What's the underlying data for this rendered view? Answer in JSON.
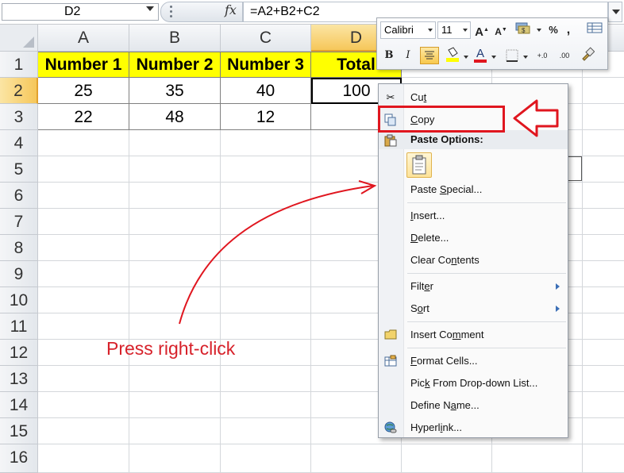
{
  "formula_bar": {
    "name_box": "D2",
    "fx_label": "fx",
    "formula": "=A2+B2+C2"
  },
  "grid": {
    "columns": [
      "A",
      "B",
      "C",
      "D"
    ],
    "rows": [
      "1",
      "2",
      "3",
      "4",
      "5",
      "6",
      "7",
      "8",
      "9",
      "10",
      "11",
      "12",
      "13",
      "14",
      "15",
      "16"
    ],
    "cells": {
      "A1": "Number 1",
      "B1": "Number 2",
      "C1": "Number 3",
      "D1": "Total",
      "A2": "25",
      "B2": "35",
      "C2": "40",
      "D2": "100",
      "A3": "22",
      "B3": "48",
      "C3": "12",
      "D3": ""
    },
    "selected_cell": "D2"
  },
  "mini_toolbar": {
    "font_name": "Calibri",
    "font_size": "11",
    "grow_font": "A",
    "shrink_font": "A",
    "currency": "$",
    "percent": "%",
    "comma": ",",
    "bold": "B",
    "italic": "I",
    "font_color_label": "A",
    "increase_decimal": "+.0",
    "decrease_decimal": ".00",
    "accent_fill": "#ffff00",
    "accent_font": "#e0161f"
  },
  "context_menu": {
    "cut": {
      "pre": "Cu",
      "key": "t",
      "post": ""
    },
    "copy": {
      "pre": "",
      "key": "C",
      "post": "opy"
    },
    "paste_options": "Paste Options:",
    "paste_special": {
      "pre": "Paste ",
      "key": "S",
      "post": "pecial..."
    },
    "insert": {
      "pre": "",
      "key": "I",
      "post": "nsert..."
    },
    "delete": {
      "pre": "",
      "key": "D",
      "post": "elete..."
    },
    "clear_contents": {
      "pre": "Clear Co",
      "key": "n",
      "post": "tents"
    },
    "filter": {
      "pre": "Filt",
      "key": "e",
      "post": "r"
    },
    "sort": {
      "pre": "S",
      "key": "o",
      "post": "rt"
    },
    "insert_comment": {
      "pre": "Insert Co",
      "key": "m",
      "post": "ment"
    },
    "format_cells": {
      "pre": "",
      "key": "F",
      "post": "ormat Cells..."
    },
    "pick_from_list": {
      "pre": "Pic",
      "key": "k",
      "post": " From Drop-down List..."
    },
    "define_name": {
      "pre": "Define N",
      "key": "a",
      "post": "me..."
    },
    "hyperlink": {
      "pre": "Hyperl",
      "key": "i",
      "post": "nk..."
    }
  },
  "annotation": {
    "text": "Press right-click",
    "color": "#d7212a"
  }
}
